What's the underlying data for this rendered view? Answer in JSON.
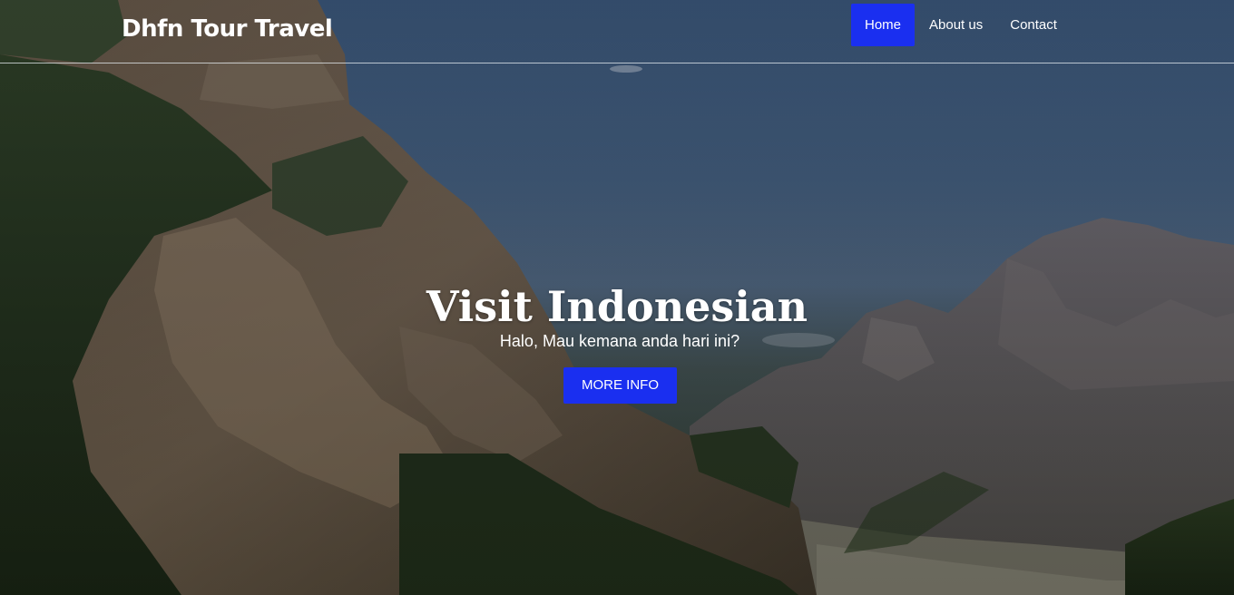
{
  "brand": {
    "name": "Dhfn Tour Travel"
  },
  "nav": {
    "items": [
      {
        "label": "Home",
        "active": true
      },
      {
        "label": "About us",
        "active": false
      },
      {
        "label": "Contact",
        "active": false
      }
    ]
  },
  "hero": {
    "title": "Visit Indonesian",
    "subtitle": "Halo, Mau kemana anda hari ini?",
    "cta_label": "MORE INFO",
    "background": "mountain-valley-photo"
  },
  "colors": {
    "accent": "#1a2ff0",
    "text": "#ffffff",
    "sky": "#4a678a"
  }
}
